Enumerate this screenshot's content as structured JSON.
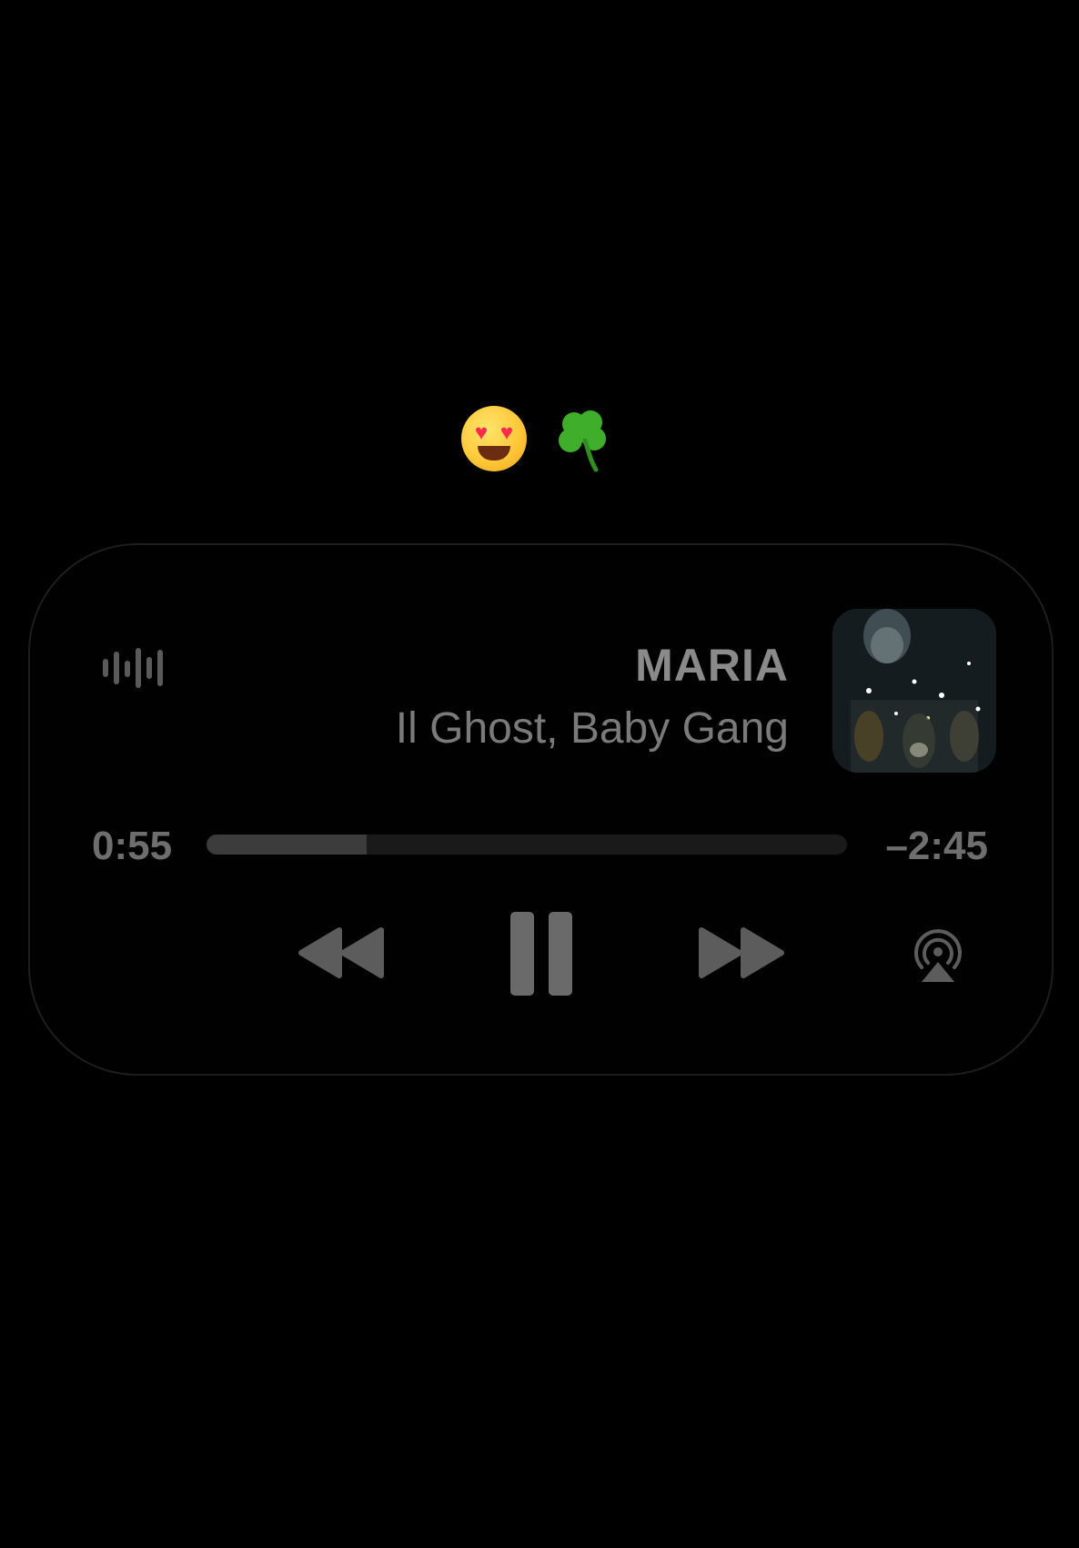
{
  "overlay": {
    "emojis": [
      "😍",
      "☘️"
    ]
  },
  "now_playing": {
    "title": "MARIA",
    "artist": "Il Ghost, Baby Gang",
    "elapsed": "0:55",
    "remaining": "–2:45",
    "progress": 0.25
  },
  "controls": {
    "rewind_icon": "backward-icon",
    "pause_icon": "pause-icon",
    "forward_icon": "forward-icon",
    "airplay_icon": "airplay-icon",
    "waveform_icon": "waveform-icon"
  },
  "colors": {
    "background": "#000000",
    "text_primary": "#8a8a8a",
    "controls": "#5c5c5c"
  }
}
